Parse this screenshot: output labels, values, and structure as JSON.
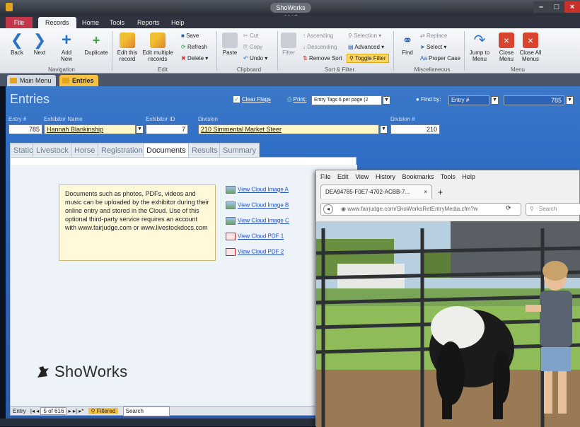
{
  "window": {
    "title": "ShoWorks 2015"
  },
  "ribbon_tabs": [
    "File",
    "Records",
    "Home",
    "Tools",
    "Reports",
    "Help"
  ],
  "ribbon": {
    "back": "Back",
    "next": "Next",
    "add_new": "Add New",
    "duplicate": "Duplicate",
    "edit_this": "Edit this record",
    "edit_multiple": "Edit multiple records",
    "save": "Save",
    "refresh": "Refresh",
    "delete": "Delete",
    "paste": "Paste",
    "cut": "Cut",
    "copy": "Copy",
    "undo": "Undo",
    "filter": "Filter",
    "ascending": "Ascending",
    "descending": "Descending",
    "remove_sort": "Remove Sort",
    "selection": "Selection",
    "advanced": "Advanced",
    "toggle_filter": "Toggle Filter",
    "find": "Find",
    "replace": "Replace",
    "select": "Select",
    "proper_case": "Proper Case",
    "jump_to": "Jump to Menu",
    "close_menu": "Close Menu",
    "close_all": "Close All Menus",
    "groups": {
      "navigation": "Navigation",
      "edit": "Edit",
      "clipboard": "Clipboard",
      "sort_filter": "Sort & Filter",
      "misc": "Miscellaneous",
      "menu": "Menu"
    }
  },
  "doc_tabs": [
    "Main Menu",
    "Entries"
  ],
  "form": {
    "title": "Entries",
    "clear_flags": "Clear Flags",
    "print_label": "Print:",
    "print_value": "Entry Tags 6 per page (2",
    "find_by_label": "Find by:",
    "find_by_value": "Entry #",
    "find_value": "785",
    "entry_label": "Entry #",
    "entry_value": "785",
    "exhibitor_label": "Exhibitor Name",
    "exhibitor_value": "Hannah Blankinship",
    "exhibitor_id_label": "Exhibitor ID",
    "exhibitor_id_value": "7",
    "division_label": "Division",
    "division_value": "210 Simmental Market Steer",
    "division_num_label": "Division #",
    "division_num_value": "210"
  },
  "subtabs": [
    "Static",
    "Livestock",
    "Horse",
    "Registration",
    "Documents",
    "Results",
    "Summary"
  ],
  "active_subtab": "Documents",
  "note": "Documents such as photos, PDFs, videos and music can be uploaded by the exhibitor during their online entry and stored in the Cloud.  Use of this optional third-party service requires an account with www.fairjudge.com or www.livestockdocs.com",
  "cloud_links": [
    "View Cloud Image A",
    "View Cloud Image B",
    "View Cloud Image C",
    "View Cloud PDF 1",
    "View Cloud PDF 2"
  ],
  "logo_text": "ShoWorks",
  "record_nav": {
    "label": "Entry",
    "position": "5 of 616",
    "filtered": "Filtered",
    "search": "Search"
  },
  "browser": {
    "menu": [
      "File",
      "Edit",
      "View",
      "History",
      "Bookmarks",
      "Tools",
      "Help"
    ],
    "tab_title": "DEA94785-F0E7-4702-ACBB-7...",
    "url": "www.fairjudge.com/ShoWorksRetEntryMedia.cfm?w",
    "search_placeholder": "Search"
  },
  "colors": {
    "accent": "#2f6fc6",
    "file_tab": "#c4374a",
    "note_bg": "#fff9d9",
    "link": "#1f4fbf"
  }
}
